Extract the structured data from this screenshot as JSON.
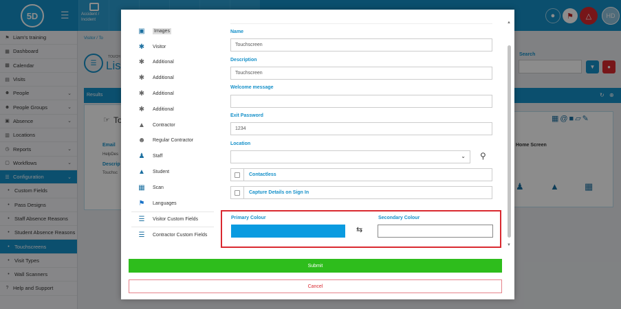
{
  "app": {
    "logo_text": "5D",
    "top_tile_label": "Accident / Incident",
    "avatar_initials": "HD"
  },
  "sidebar": {
    "items": [
      {
        "label": "Liam's training",
        "icon": "flag-icon",
        "chevron": false
      },
      {
        "label": "Dashboard",
        "icon": "dashboard-icon",
        "chevron": false
      },
      {
        "label": "Calendar",
        "icon": "calendar-icon",
        "chevron": false
      },
      {
        "label": "Visits",
        "icon": "list-icon",
        "chevron": false
      },
      {
        "label": "People",
        "icon": "people-icon",
        "chevron": true
      },
      {
        "label": "People Groups",
        "icon": "group-icon",
        "chevron": true
      },
      {
        "label": "Absence",
        "icon": "absence-icon",
        "chevron": true
      },
      {
        "label": "Locations",
        "icon": "building-icon",
        "chevron": false
      },
      {
        "label": "Reports",
        "icon": "clock-icon",
        "chevron": true
      },
      {
        "label": "Workflows",
        "icon": "workflow-icon",
        "chevron": true
      },
      {
        "label": "Configuration",
        "icon": "config-icon",
        "chevron": true,
        "active": true
      },
      {
        "label": "Custom Fields",
        "sub": true
      },
      {
        "label": "Pass Designs",
        "sub": true
      },
      {
        "label": "Staff Absence Reasons",
        "sub": true
      },
      {
        "label": "Student Absence Reasons",
        "sub": true
      },
      {
        "label": "Touchscreens",
        "sub": true,
        "active": true
      },
      {
        "label": "Visit Types",
        "sub": true
      },
      {
        "label": "Wall Scanners",
        "sub": true
      },
      {
        "label": "Help and Support",
        "icon": "help-icon",
        "chevron": false
      }
    ]
  },
  "background": {
    "breadcrumb": "Visitor  /  To",
    "title_fragment": "Lis",
    "small_label": "TOUCH",
    "results_label": "Results",
    "card_title_fragment": "To",
    "email_label": "Email",
    "email_value": "HelpDes",
    "desc_label": "Descrip",
    "desc_value": "Touchsc",
    "search_label": "Search",
    "home_screen_label": "Home Screen"
  },
  "modal": {
    "menu": [
      {
        "label": "Images",
        "icon": "image-icon"
      },
      {
        "label": "Visitor",
        "icon": "walking-person-icon"
      },
      {
        "label": "Additional",
        "icon": "walking-person-icon"
      },
      {
        "label": "Additional",
        "icon": "walking-person-icon"
      },
      {
        "label": "Additional",
        "icon": "walking-person-icon"
      },
      {
        "label": "Additional",
        "icon": "walking-person-icon"
      },
      {
        "label": "Contractor",
        "icon": "hard-hat-icon"
      },
      {
        "label": "Regular Contractor",
        "icon": "contractor-group-icon"
      },
      {
        "label": "Staff",
        "icon": "staff-icon"
      },
      {
        "label": "Student",
        "icon": "graduate-icon"
      },
      {
        "label": "Scan",
        "icon": "qr-code-icon"
      },
      {
        "label": "Languages",
        "icon": "flag-icon"
      },
      {
        "label": "Visitor Custom Fields",
        "icon": "checklist-icon"
      },
      {
        "label": "Contractor Custom Fields",
        "icon": "checklist-icon"
      }
    ],
    "form": {
      "name_label": "Name",
      "name_value": "Touchscreen",
      "description_label": "Description",
      "description_value": "Touchscreen",
      "welcome_label": "Welcome message",
      "welcome_value": "",
      "exit_password_label": "Exit Password",
      "exit_password_value": "1234",
      "location_label": "Location",
      "location_value": "",
      "contactless_label": "Contactless",
      "capture_label": "Capture Details on Sign In",
      "primary_colour_label": "Primary Colour",
      "secondary_colour_label": "Secondary Colour",
      "primary_colour": "#0a9be0",
      "secondary_colour": "#ffffff"
    },
    "submit_label": "Submit",
    "cancel_label": "Cancel"
  },
  "colors": {
    "brand_blue": "#1590c9",
    "submit_green": "#2ebd1c",
    "danger_red": "#d9282f"
  }
}
